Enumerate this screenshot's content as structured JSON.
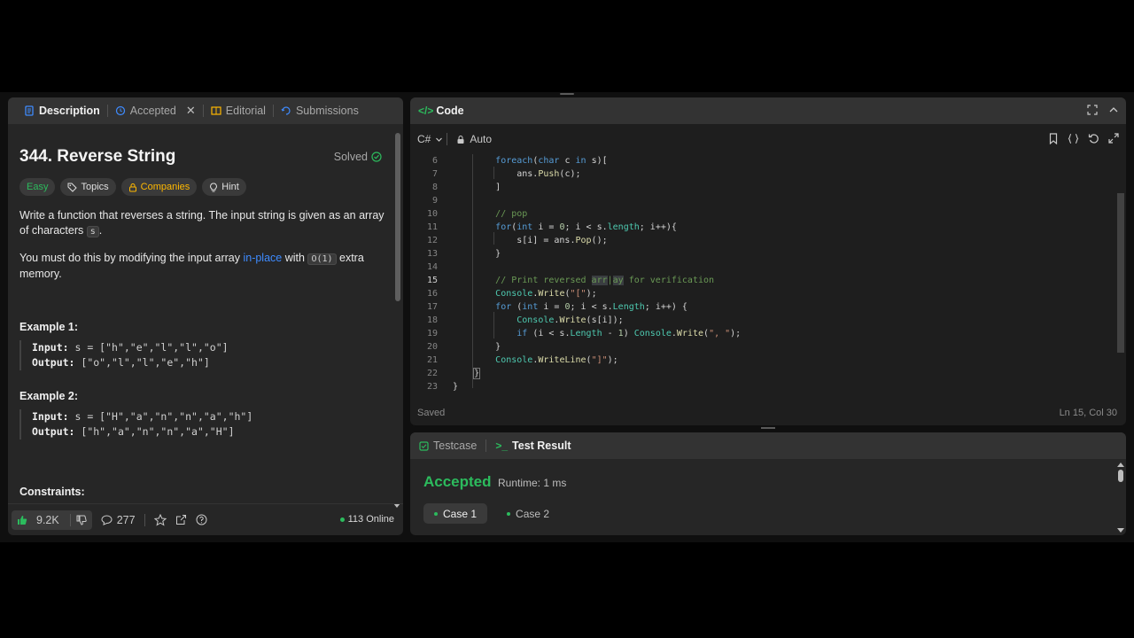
{
  "left_tabs": [
    {
      "label": "Description",
      "icon": "description-icon"
    },
    {
      "label": "Accepted",
      "icon": "history-icon"
    },
    {
      "label": "Editorial",
      "icon": "book-icon"
    },
    {
      "label": "Submissions",
      "icon": "submissions-icon"
    }
  ],
  "problem": {
    "title": "344. Reverse String",
    "solved_label": "Solved",
    "tags": {
      "difficulty": "Easy",
      "topics": "Topics",
      "companies": "Companies",
      "hint": "Hint"
    },
    "para1_a": "Write a function that reverses a string. The input string is given as an array of characters ",
    "para1_code": "s",
    "para1_b": ".",
    "para2_a": "You must do this by modifying the input array ",
    "para2_link": "in-place",
    "para2_b": " with ",
    "para2_code": "O(1)",
    "para2_c": " extra memory.",
    "example1_title": "Example 1:",
    "example1_input_label": "Input:",
    "example1_input": "s = [\"h\",\"e\",\"l\",\"l\",\"o\"]",
    "example1_output_label": "Output:",
    "example1_output": "[\"o\",\"l\",\"l\",\"e\",\"h\"]",
    "example2_title": "Example 2:",
    "example2_input_label": "Input:",
    "example2_input": "s = [\"H\",\"a\",\"n\",\"n\",\"a\",\"h\"]",
    "example2_output_label": "Output:",
    "example2_output": "[\"h\",\"a\",\"n\",\"n\",\"a\",\"H\"]",
    "constraints_title": "Constraints:"
  },
  "bottom_bar": {
    "likes": "9.2K",
    "comments": "277",
    "online": "113 Online"
  },
  "code_panel": {
    "title": "Code",
    "language": "C#",
    "mode": "Auto",
    "status_left": "Saved",
    "status_right": "Ln 15, Col 30",
    "line_numbers": [
      "6",
      "7",
      "8",
      "9",
      "10",
      "11",
      "12",
      "13",
      "14",
      "15",
      "16",
      "17",
      "18",
      "19",
      "20",
      "21",
      "22",
      "23"
    ],
    "current_line": "15"
  },
  "test_panel": {
    "tab_testcase": "Testcase",
    "tab_result": "Test Result",
    "verdict": "Accepted",
    "runtime": "Runtime: 1 ms",
    "cases": [
      "Case 1",
      "Case 2"
    ]
  },
  "colors": {
    "accent_green": "#2cbb5d",
    "link_blue": "#3e8bff",
    "companies_yellow": "#ffb800"
  }
}
